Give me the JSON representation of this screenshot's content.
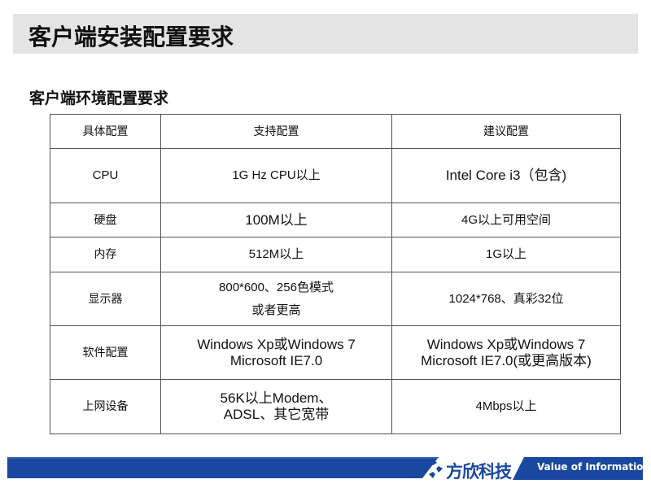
{
  "title": "客户端安装配置要求",
  "subtitle": "客户端环境配置要求",
  "table": {
    "headers": [
      "具体配置",
      "支持配置",
      "建议配置"
    ],
    "rows": [
      {
        "item": "CPU",
        "supported": [
          "1G Hz CPU以上"
        ],
        "recommended": [
          "Intel Core i3（包含)"
        ]
      },
      {
        "item": "硬盘",
        "supported": [
          "100M以上"
        ],
        "recommended": [
          "4G以上可用空间"
        ]
      },
      {
        "item": "内存",
        "supported": [
          "512M以上"
        ],
        "recommended": [
          "1G以上"
        ]
      },
      {
        "item": "显示器",
        "supported": [
          "800*600、256色模式",
          "或者更高"
        ],
        "recommended": [
          "1024*768、真彩32位"
        ]
      },
      {
        "item": "软件配置",
        "supported": [
          "Windows Xp或Windows 7",
          "Microsoft IE7.0"
        ],
        "recommended": [
          "Windows Xp或Windows 7",
          "Microsoft IE7.0(或更高版本)"
        ]
      },
      {
        "item": "上网设备",
        "supported": [
          "56K以上Modem、",
          "ADSL、其它宽带"
        ],
        "recommended": [
          "4Mbps以上"
        ]
      }
    ]
  },
  "footer": {
    "company": "方欣科技",
    "slogan": "Value of Information",
    "logo_icon": "four-arrow-logo-icon",
    "brand_color": "#1a48a0"
  }
}
